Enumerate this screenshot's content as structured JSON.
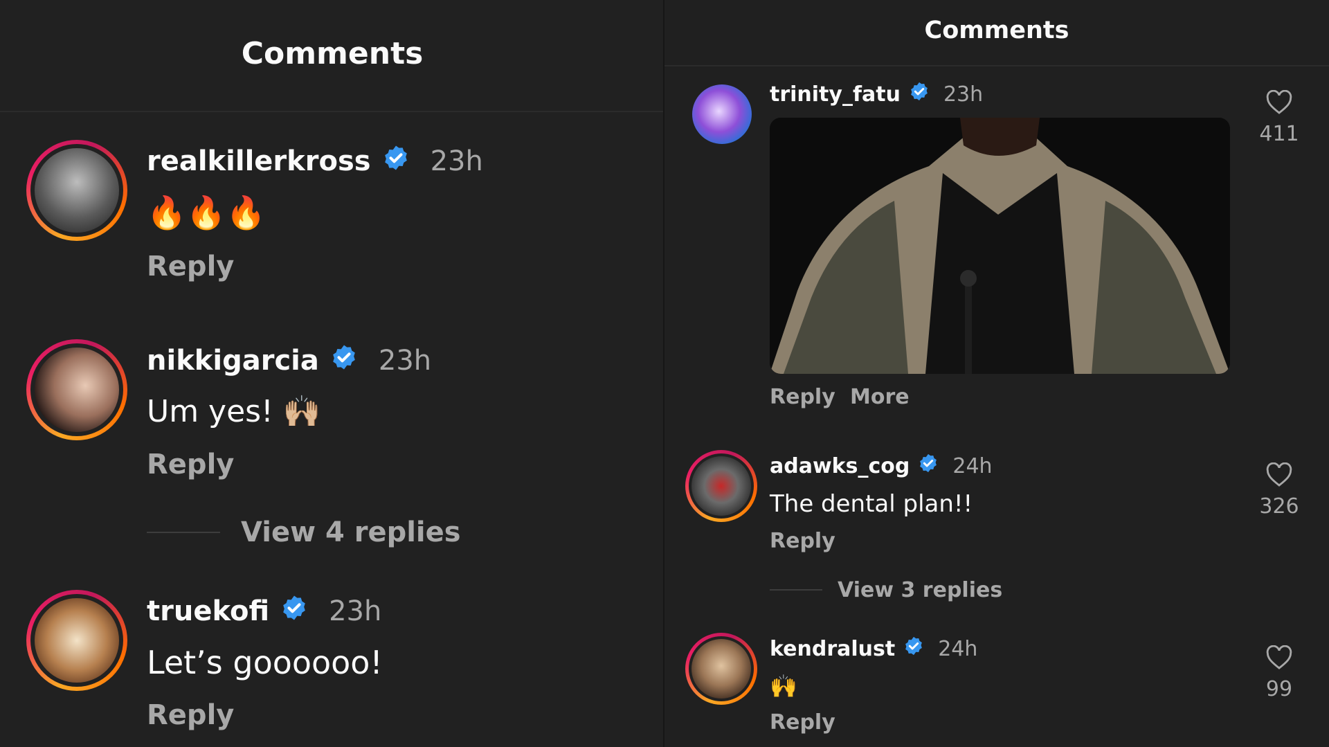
{
  "left": {
    "title": "Comments",
    "comments": [
      {
        "username": "realkillerkross",
        "time": "23h",
        "text": "🔥🔥🔥",
        "reply": "Reply"
      },
      {
        "username": "nikkigarcia",
        "time": "23h",
        "text": "Um yes! 🙌🏼",
        "reply": "Reply",
        "view_replies": "View 4 replies"
      },
      {
        "username": "truekofi",
        "time": "23h",
        "text": "Let’s goooooo!",
        "reply": "Reply"
      }
    ]
  },
  "right": {
    "title": "Comments",
    "comments": [
      {
        "username": "trinity_fatu",
        "time": "23h",
        "reply": "Reply",
        "more": "More",
        "likes": "411"
      },
      {
        "username": "adawks_cog",
        "time": "24h",
        "text": "The dental plan!!",
        "reply": "Reply",
        "view_replies": "View 3 replies",
        "likes": "326"
      },
      {
        "username": "kendralust",
        "time": "24h",
        "text": "🙌",
        "reply": "Reply",
        "likes": "99"
      }
    ]
  },
  "colors": {
    "background": "#212121",
    "verified": "#3897f0",
    "secondary_text": "#a8a8a8",
    "primary_text": "#fafafa"
  },
  "icons": [
    "verified-badge-icon",
    "heart-outline-icon"
  ]
}
